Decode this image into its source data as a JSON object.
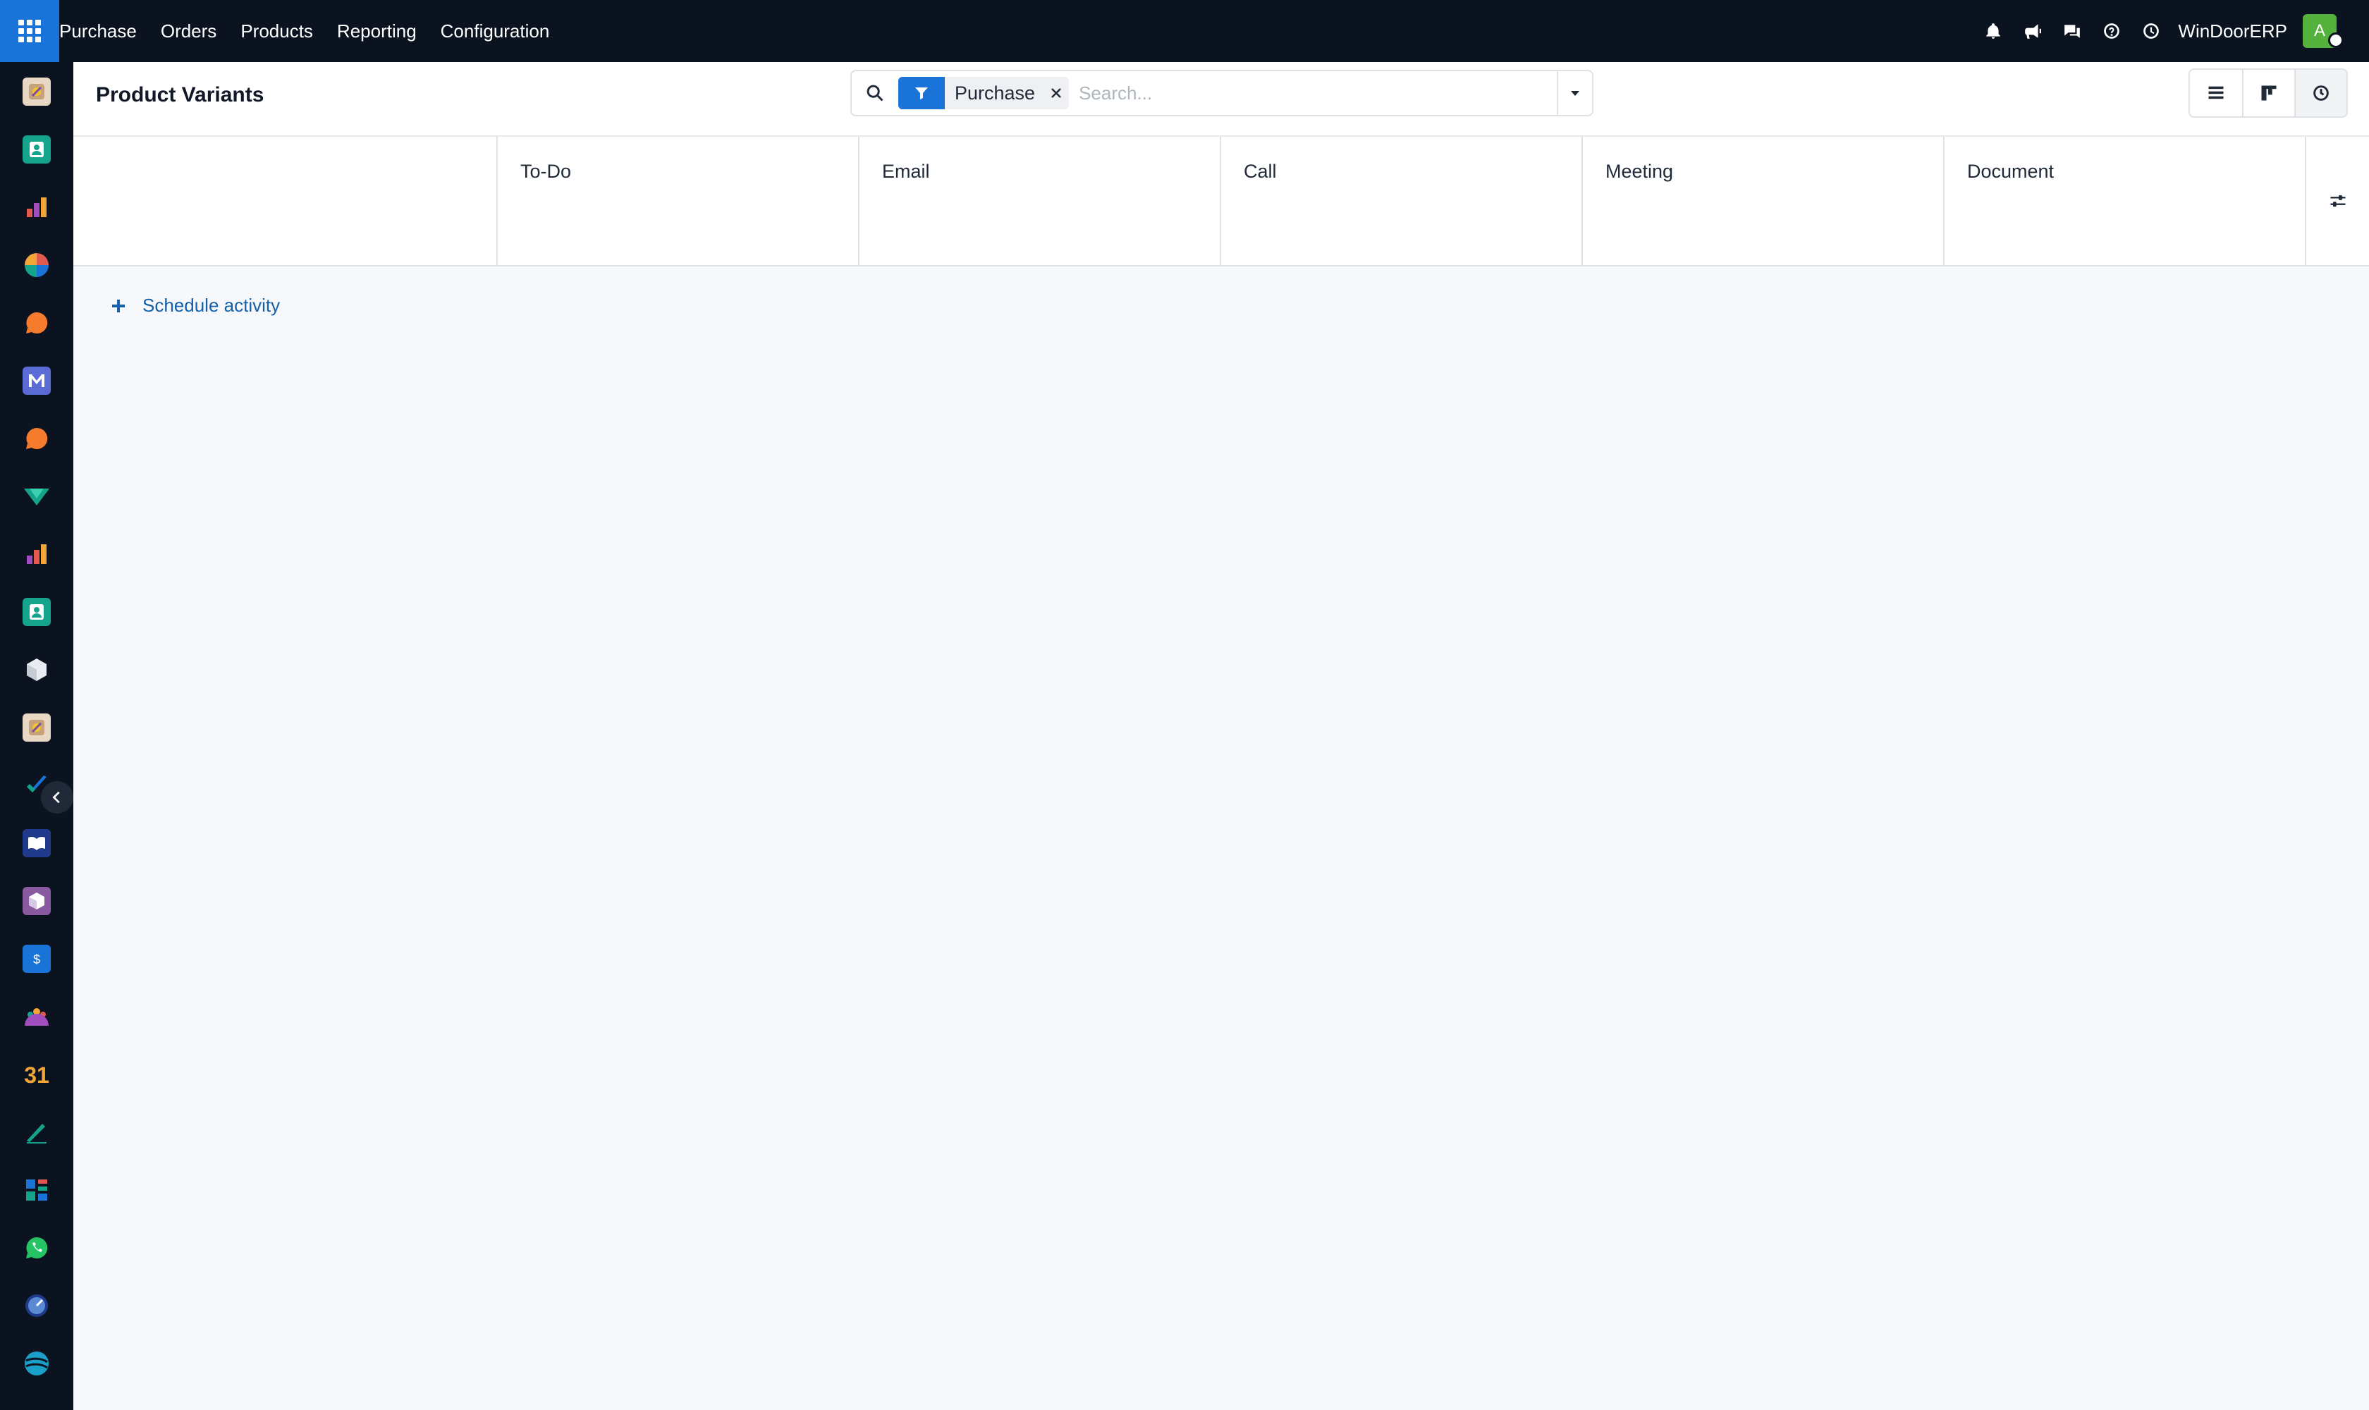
{
  "navbar": {
    "apps_icon": "apps-grid-icon",
    "menu": [
      "Purchase",
      "Orders",
      "Products",
      "Reporting",
      "Configuration"
    ],
    "systray_icons": [
      "bell-icon",
      "megaphone-icon",
      "chat-icon",
      "help-icon",
      "clock-icon"
    ],
    "company": "WinDoorERP",
    "avatar_initial": "A",
    "avatar_color": "#53b13c"
  },
  "sidebar": {
    "apps": [
      "purchase-app",
      "contacts-app",
      "reporting-app",
      "dashboard-app",
      "discuss-app",
      "email-marketing-app",
      "livechat-app",
      "project-app",
      "sales-app",
      "employees-app",
      "inventory-app",
      "purchase-app-2",
      "todo-app",
      "knowledge-app",
      "product-app",
      "invoicing-app",
      "team-app",
      "calendar-app",
      "sign-app",
      "dashboards-app",
      "whatsapp-app",
      "timesheet-app",
      "website-app"
    ]
  },
  "control_panel": {
    "title": "Product Variants",
    "facet": "Purchase",
    "search_placeholder": "Search..."
  },
  "views": [
    "list-view-icon",
    "kanban-view-icon",
    "activity-view-icon"
  ],
  "table": {
    "columns": [
      "To-Do",
      "Email",
      "Call",
      "Meeting",
      "Document"
    ]
  },
  "schedule_activity": "Schedule activity",
  "colors": {
    "navbar_bg": "#0c1320",
    "accent": "#1a73d6",
    "link": "#1560a8",
    "body_bg": "#f6f8fb"
  }
}
